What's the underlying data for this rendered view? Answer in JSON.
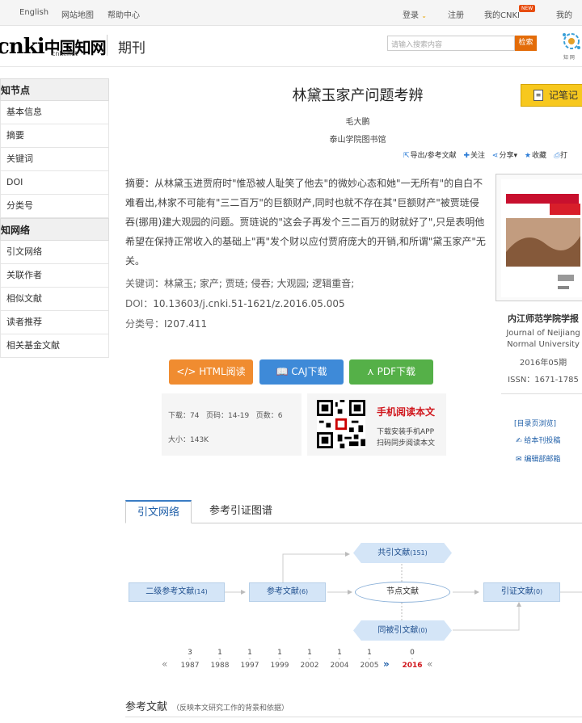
{
  "topbar": {
    "english": "English",
    "sitemap": "网站地图",
    "help": "帮助中心",
    "login": "登录",
    "register": "注册",
    "my_cnki": "我的CNKI",
    "new_badge": "NEW",
    "my_right": "我的"
  },
  "header": {
    "logo_main": "cnki",
    "logo_cn": "中国知网",
    "logo_sub": "cnki.net",
    "section": "期刊",
    "search_placeholder": "请输入搜索内容",
    "search_button": "检索"
  },
  "sidebar": {
    "section1": "知节点",
    "items1": [
      "基本信息",
      "摘要",
      "关键词",
      "DOI",
      "分类号"
    ],
    "section2": "知网络",
    "items2": [
      "引文网络",
      "关联作者",
      "相似文献",
      "读者推荐",
      "相关基金文献"
    ]
  },
  "article": {
    "title": "林黛玉家产问题考辨",
    "author": "毛大鹏",
    "org": "泰山学院图书馆",
    "note_button": "记笔记",
    "tools": {
      "export": "导出/参考文献",
      "follow": "关注",
      "share": "分享",
      "collect": "收藏",
      "print": "打"
    },
    "abstract_label": "摘要：",
    "abstract": "从林黛玉进贾府时\"惟恐被人耻笑了他去\"的微妙心态和她\"一无所有\"的自白不难看出,林家不可能有\"三二百万\"的巨额财产,同时也就不存在其\"巨额财产\"被贾琏侵吞(挪用)建大观园的问题。贾琏说的\"这会子再发个三二百万的财就好了\",只是表明他希望在保持正常收入的基础上\"再\"发个财以应付贾府庞大的开销,和所谓\"黛玉家产\"无关。",
    "keywords_label": "关键词：",
    "keywords": "林黛玉; 家产; 贾琏; 侵吞; 大观园; 逻辑重音;",
    "doi_label": "DOI：",
    "doi": "10.13603/j.cnki.51-1621/z.2016.05.005",
    "class_label": "分类号：",
    "class_no": "I207.411"
  },
  "journal": {
    "name": "内江师范学院学报",
    "name_en": "Journal of Neijiang Normal University",
    "issue": "2016年05期",
    "issn": "ISSN：1671-1785",
    "toc_link": "[目录页浏览]",
    "submit_link": "给本刊投稿",
    "editor_link": "编辑部邮箱"
  },
  "downloads": {
    "html": "HTML阅读",
    "caj": "CAJ下载",
    "pdf": "PDF下载"
  },
  "stats": {
    "downloads": "下载：74",
    "pages": "页码：14-19",
    "page_count": "页数：6",
    "size": "大小：143K"
  },
  "mobile": {
    "title": "手机阅读本文",
    "line1": "下载安装手机APP",
    "line2": "扫码同步阅读本文"
  },
  "tabs": [
    "引文网络",
    "参考引证图谱"
  ],
  "network": {
    "secondary_refs": "二级参考文献",
    "secondary_refs_count": "(14)",
    "refs": "参考文献",
    "refs_count": "(6)",
    "node": "节点文献",
    "cocited": "共引文献",
    "cocited_count": "(151)",
    "cociting": "同被引文献",
    "cociting_count": "(0)",
    "citing": "引证文献",
    "citing_count": "(0)"
  },
  "timeline": [
    {
      "count": "3",
      "year": "1987"
    },
    {
      "count": "1",
      "year": "1988"
    },
    {
      "count": "1",
      "year": "1997"
    },
    {
      "count": "1",
      "year": "1999"
    },
    {
      "count": "1",
      "year": "2002"
    },
    {
      "count": "1",
      "year": "2004"
    },
    {
      "count": "1",
      "year": "2005"
    },
    {
      "count": "0",
      "year": "2016"
    }
  ],
  "references": {
    "title": "参考文献",
    "note": "（反映本文研究工作的背景和依据）"
  },
  "colors": {
    "accent_blue": "#1f5fa8",
    "orange": "#f08c30",
    "green": "#55b048",
    "red": "#d0161c"
  }
}
